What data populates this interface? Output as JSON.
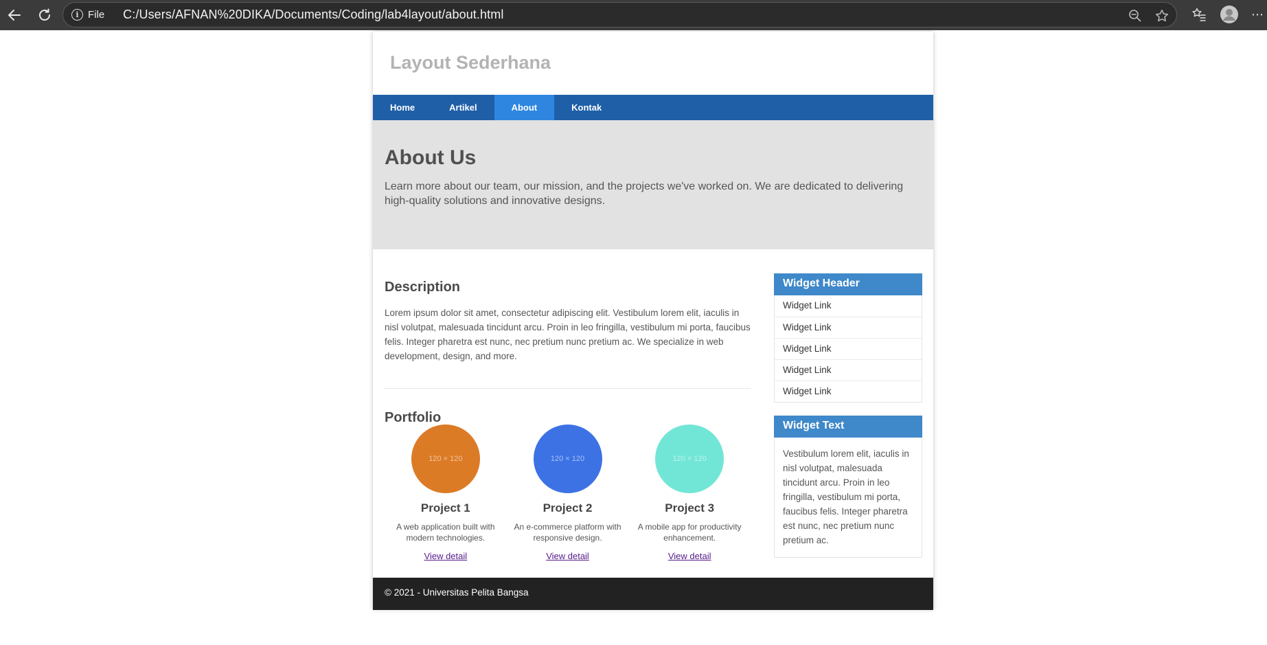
{
  "browser": {
    "file_label": "File",
    "url": "C:/Users/AFNAN%20DIKA/Documents/Coding/lab4layout/about.html",
    "icons": [
      "back-icon",
      "refresh-icon",
      "info-icon",
      "zoom-icon",
      "star-icon",
      "favorites-icon",
      "profile-icon",
      "more-icon"
    ]
  },
  "site": {
    "title": "Layout Sederhana"
  },
  "nav": {
    "items": [
      {
        "label": "Home"
      },
      {
        "label": "Artikel"
      },
      {
        "label": "About"
      },
      {
        "label": "Kontak"
      }
    ],
    "active": "About"
  },
  "hero": {
    "title": "About Us",
    "text": "Learn more about our team, our mission, and the projects we've worked on. We are dedicated to delivering high-quality solutions and innovative designs."
  },
  "description": {
    "title": "Description",
    "text": "Lorem ipsum dolor sit amet, consectetur adipiscing elit. Vestibulum lorem elit, iaculis in nisl volutpat, malesuada tincidunt arcu. Proin in leo fringilla, vestibulum mi porta, faucibus felis. Integer pharetra est nunc, nec pretium nunc pretium ac. We specialize in web development, design, and more."
  },
  "portfolio": {
    "title": "Portfolio",
    "projects": [
      {
        "image_label": "120 × 120",
        "color": "#dc7b26",
        "title": "Project 1",
        "desc": "A web application built with modern technologies.",
        "link": "View detail"
      },
      {
        "image_label": "120 × 120",
        "color": "#3c72e4",
        "title": "Project 2",
        "desc": "An e-commerce platform with responsive design.",
        "link": "View detail"
      },
      {
        "image_label": "120 × 120",
        "color": "#72e6d6",
        "title": "Project 3",
        "desc": "A mobile app for productivity enhancement.",
        "link": "View detail"
      }
    ]
  },
  "sidebar": {
    "widget1": {
      "header": "Widget Header",
      "links": [
        "Widget Link",
        "Widget Link",
        "Widget Link",
        "Widget Link",
        "Widget Link"
      ]
    },
    "widget2": {
      "header": "Widget Text",
      "text": "Vestibulum lorem elit, iaculis in nisl volutpat, malesuada tincidunt arcu. Proin in leo fringilla, vestibulum mi porta, faucibus felis. Integer pharetra est nunc, nec pretium nunc pretium ac."
    }
  },
  "footer": {
    "text": "© 2021 - Universitas Pelita Bangsa"
  },
  "colors": {
    "nav_bg": "#1f5fa8",
    "nav_active": "#2f86e0",
    "widget_header": "#3f88c9",
    "hero_bg": "#e2e2e2",
    "footer_bg": "#222222"
  }
}
